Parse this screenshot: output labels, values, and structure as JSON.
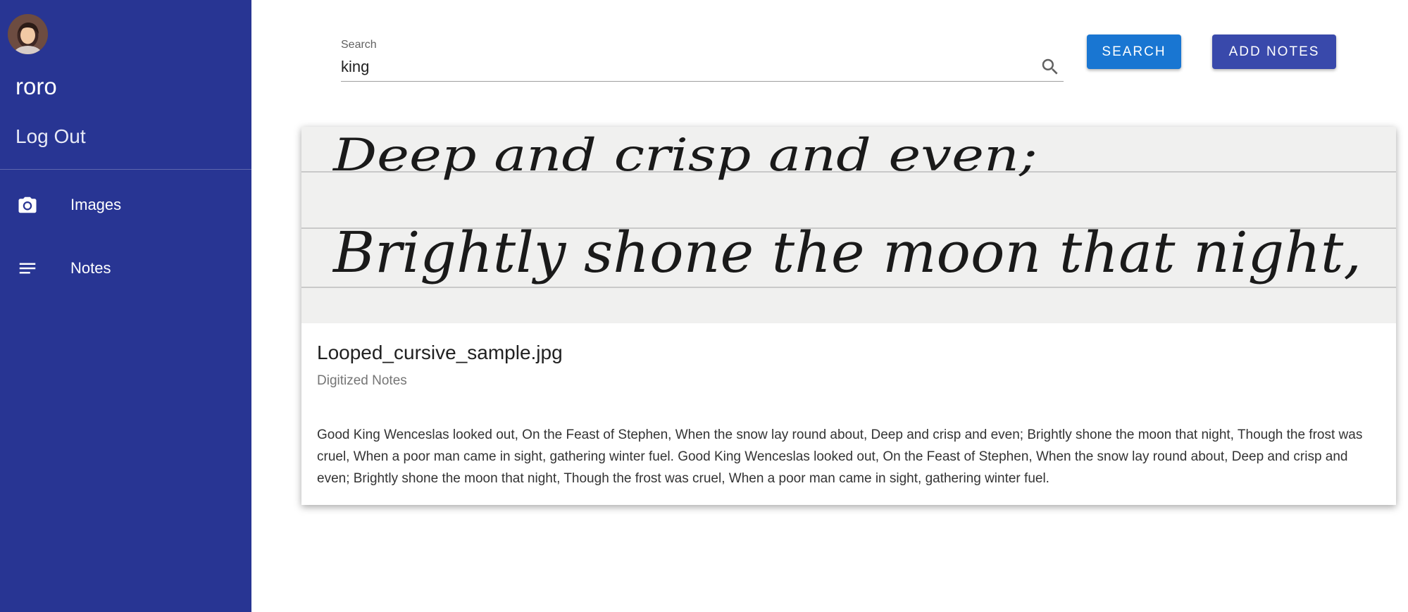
{
  "sidebar": {
    "avatar_icon": "avatar-photo",
    "username": "roro",
    "logout_label": "Log Out",
    "items": [
      {
        "icon": "camera-icon",
        "label": "Images"
      },
      {
        "icon": "notes-icon",
        "label": "Notes"
      }
    ],
    "background": "#283593"
  },
  "search": {
    "label": "Search",
    "value": "king",
    "icon": "search-icon",
    "button_label": "SEARCH",
    "button_color": "#1976d2"
  },
  "add_notes": {
    "label": "ADD NOTES",
    "color": "#3949ab"
  },
  "card": {
    "image_text": {
      "line1": "Deep and crisp and even;",
      "line2": "Brightly shone the moon that night,"
    },
    "title": "Looped_cursive_sample.jpg",
    "subtitle": "Digitized Notes",
    "body": "Good King Wenceslas looked out, On the Feast of Stephen, When the snow lay round about, Deep and crisp and even; Brightly shone the moon that night, Though the frost was cruel, When a poor man came in sight, gathering winter fuel. Good King Wenceslas looked out, On the Feast of Stephen, When the snow lay round about, Deep and crisp and even; Brightly shone the moon that night, Though the frost was cruel, When a poor man came in sight, gathering winter fuel."
  }
}
